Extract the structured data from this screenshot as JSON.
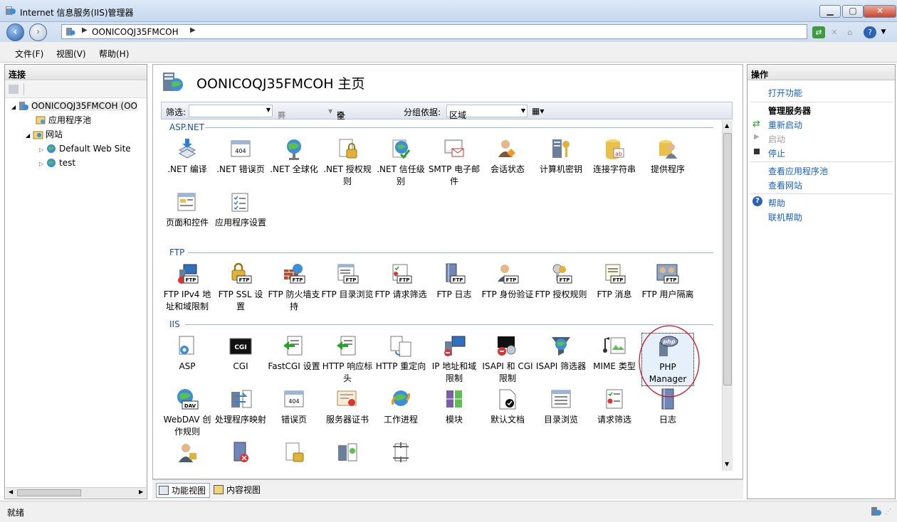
{
  "window": {
    "title": "Internet 信息服务(IIS)管理器"
  },
  "address": {
    "crumbs": [
      "OONICOQJ35FMCOH"
    ]
  },
  "menu": {
    "file": "文件(F)",
    "view": "视图(V)",
    "help": "帮助(H)"
  },
  "connections": {
    "header": "连接",
    "tree": [
      {
        "label": "OONICOQJ35FMCOH (OO",
        "level": 0
      },
      {
        "label": "应用程序池",
        "level": 1
      },
      {
        "label": "网站",
        "level": 1
      },
      {
        "label": "Default Web Site",
        "level": 2
      },
      {
        "label": "test",
        "level": 2
      }
    ]
  },
  "main": {
    "title": "OONICOQJ35FMCOH 主页",
    "filter_label": "筛选:",
    "start_label": "开始(G)",
    "showall_label": "全部显示(A)",
    "groupby_label": "分组依据:",
    "groupby_value": "区域"
  },
  "groups": {
    "aspnet": {
      "name": "ASP.NET",
      "items": [
        ".NET 编译",
        ".NET 错误页",
        ".NET 全球化",
        ".NET 授权规则",
        ".NET 信任级别",
        "SMTP 电子邮件",
        "会话状态",
        "计算机密钥",
        "连接字符串",
        "提供程序",
        "页面和控件",
        "应用程序设置"
      ]
    },
    "ftp": {
      "name": "FTP",
      "items": [
        "FTP IPv4 地址和域限制",
        "FTP SSL 设置",
        "FTP 防火墙支持",
        "FTP 目录浏览",
        "FTP 请求筛选",
        "FTP 日志",
        "FTP 身份验证",
        "FTP 授权规则",
        "FTP 消息",
        "FTP 用户隔离"
      ]
    },
    "iis": {
      "name": "IIS",
      "items": [
        "ASP",
        "CGI",
        "FastCGI 设置",
        "HTTP 响应标头",
        "HTTP 重定向",
        "IP 地址和域限制",
        "ISAPI 和 CGI 限制",
        "ISAPI 筛选器",
        "MIME 类型",
        "PHP Manager",
        "WebDAV 创作规则",
        "处理程序映射",
        "错误页",
        "服务器证书",
        "工作进程",
        "模块",
        "默认文档",
        "目录浏览",
        "请求筛选",
        "日志"
      ]
    }
  },
  "bottom_tabs": {
    "features": "功能视图",
    "content": "内容视图"
  },
  "actions": {
    "header": "操作",
    "open_feature": "打开功能",
    "manage_server": "管理服务器",
    "restart": "重新启动",
    "start": "启动",
    "stop": "停止",
    "view_pools": "查看应用程序池",
    "view_sites": "查看网站",
    "help": "帮助",
    "online_help": "联机帮助"
  },
  "status": {
    "text": "就绪"
  }
}
